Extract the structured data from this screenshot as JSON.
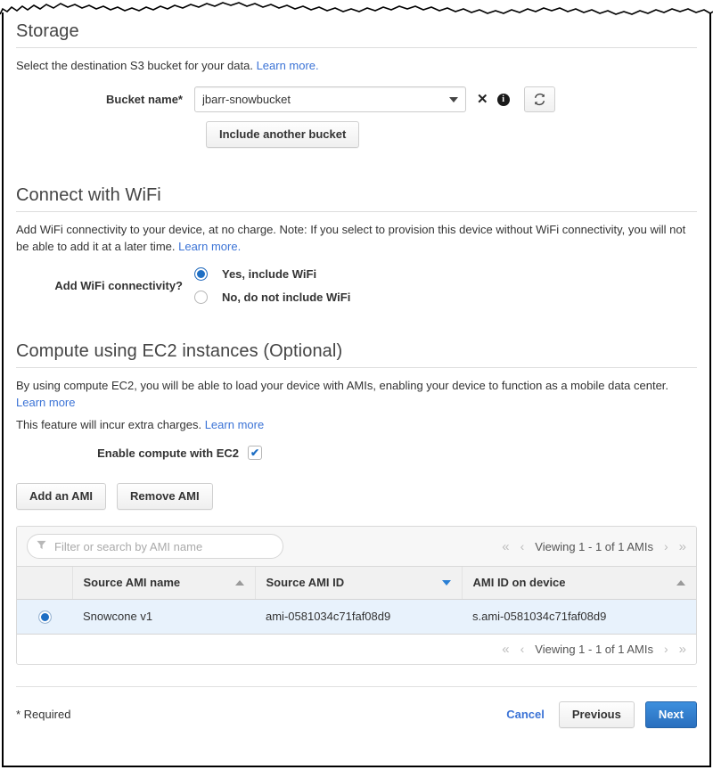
{
  "storage": {
    "title": "Storage",
    "description_prefix": "Select the destination S3 bucket for your data. ",
    "learn_more": "Learn more.",
    "bucket_label": "Bucket name*",
    "bucket_value": "jbarr-snowbucket",
    "remove_icon": "✕",
    "info_icon": "i",
    "refresh_icon": "refresh",
    "include_another_bucket": "Include another bucket"
  },
  "wifi": {
    "title": "Connect with WiFi",
    "description_prefix": "Add WiFi connectivity to your device, at no charge. Note: If you select to provision this device without WiFi connectivity, you will not be able to add it at a later time. ",
    "learn_more": "Learn more.",
    "question_label": "Add WiFi connectivity?",
    "options": [
      {
        "label": "Yes, include WiFi",
        "selected": true
      },
      {
        "label": "No, do not include WiFi",
        "selected": false
      }
    ]
  },
  "compute": {
    "title": "Compute using EC2 instances (Optional)",
    "description_prefix": "By using compute EC2, you will be able to load your device with AMIs, enabling your device to function as a mobile data center. ",
    "learn_more": "Learn more",
    "charges_prefix": "This feature will incur extra charges. ",
    "charges_learn_more": "Learn more",
    "enable_label": "Enable compute with EC2",
    "enable_checked": true,
    "check_glyph": "✔",
    "add_ami_button": "Add an AMI",
    "remove_ami_button": "Remove AMI"
  },
  "ami_table": {
    "filter_placeholder": "Filter or search by AMI name",
    "filter_value": "",
    "funnel_icon": "▼",
    "pagination": {
      "first": "«",
      "prev": "‹",
      "text": "Viewing 1 - 1 of 1 AMIs",
      "next": "›",
      "last": "»"
    },
    "columns": [
      {
        "label": "Source AMI name",
        "sort": "asc"
      },
      {
        "label": "Source AMI ID",
        "sort": "desc"
      },
      {
        "label": "AMI ID on device",
        "sort": "asc"
      }
    ],
    "rows": [
      {
        "selected": true,
        "source_ami_name": "Snowcone v1",
        "source_ami_id": "ami-0581034c71faf08d9",
        "ami_id_on_device": "s.ami-0581034c71faf08d9"
      }
    ]
  },
  "footer": {
    "required_note": "* Required",
    "cancel": "Cancel",
    "previous": "Previous",
    "next": "Next"
  },
  "colors": {
    "link": "#3b73d6",
    "primary_button": "#2a6fbe",
    "selected_row": "#e8f2fc",
    "sort_active": "#2a7fd4"
  }
}
